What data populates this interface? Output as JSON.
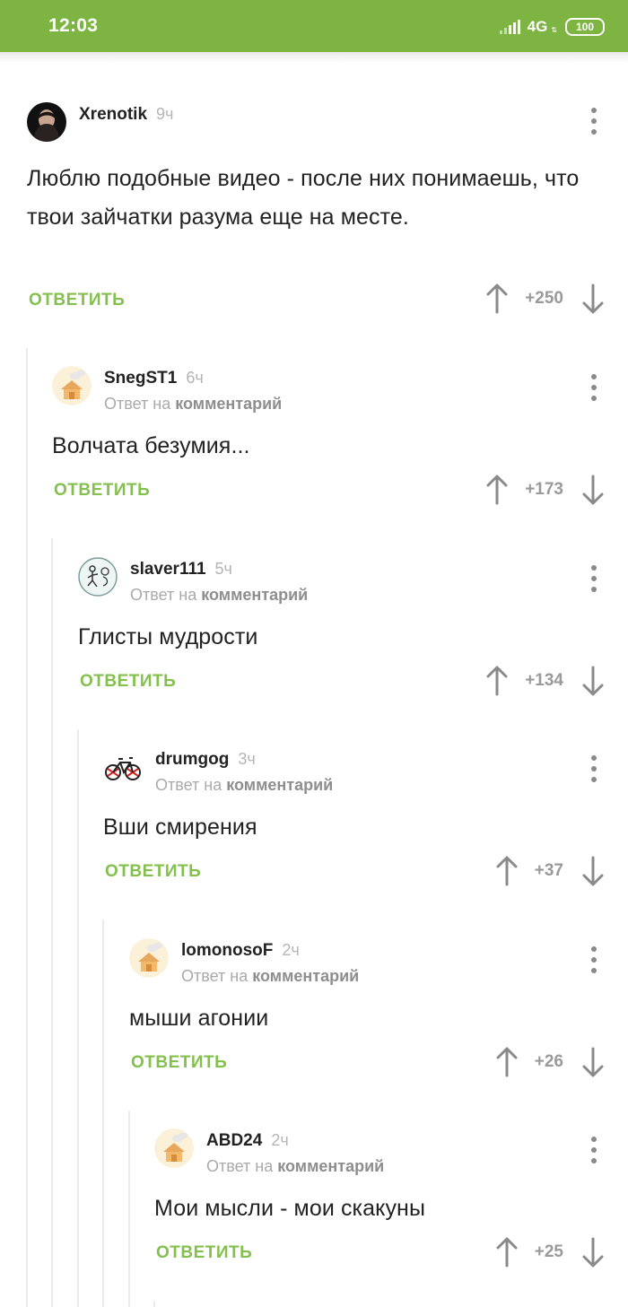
{
  "status_bar": {
    "time": "12:03",
    "network": "4G",
    "network_arrows": "⇅",
    "battery": "100"
  },
  "comments": [
    {
      "username": "Xrenotik",
      "time": "9ч",
      "text": "Люблю подобные видео - после них понимаешь, что твои зайчатки разума еще на месте.",
      "reply_label": "ОТВЕТИТЬ",
      "rating": "+250",
      "avatar": "photo-avatar"
    },
    {
      "username": "SnegST1",
      "time": "6ч",
      "reply_prefix": "Ответ на",
      "reply_link": "комментарий",
      "text": "Волчата безумия...",
      "reply_label": "ОТВЕТИТЬ",
      "rating": "+173",
      "avatar": "house-avatar"
    },
    {
      "username": "slaver111",
      "time": "5ч",
      "reply_prefix": "Ответ на",
      "reply_link": "комментарий",
      "text": "Глисты мудрости",
      "reply_label": "ОТВЕТИТЬ",
      "rating": "+134",
      "avatar": "sketch-avatar"
    },
    {
      "username": "drumgog",
      "time": "3ч",
      "reply_prefix": "Ответ на",
      "reply_link": "комментарий",
      "text": "Вши смирения",
      "reply_label": "ОТВЕТИТЬ",
      "rating": "+37",
      "avatar": "bicycle-avatar"
    },
    {
      "username": "lomonosoF",
      "time": "2ч",
      "reply_prefix": "Ответ на",
      "reply_link": "комментарий",
      "text": "мыши агонии",
      "reply_label": "ОТВЕТИТЬ",
      "rating": "+26",
      "avatar": "house-avatar"
    },
    {
      "username": "ABD24",
      "time": "2ч",
      "reply_prefix": "Ответ на",
      "reply_link": "комментарий",
      "text": "Мои мысли - мои скакуны",
      "reply_label": "ОТВЕТИТЬ",
      "rating": "+25",
      "avatar": "house-avatar"
    }
  ],
  "colors": {
    "accent_green": "#84c04e",
    "status_bar_green": "#7db442",
    "vote_arrow": "#8a8a8a"
  }
}
